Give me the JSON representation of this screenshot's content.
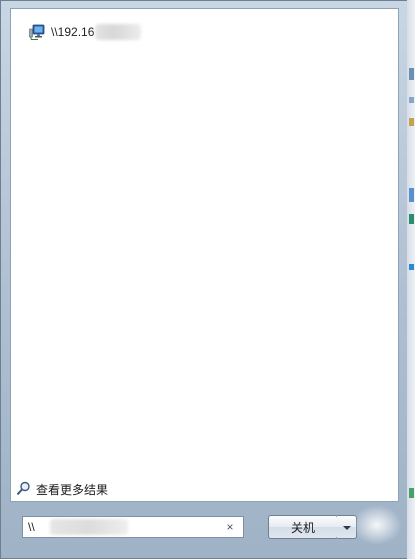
{
  "results": {
    "items": [
      {
        "label": "\\\\192.16",
        "icon": "network-computer-icon"
      }
    ]
  },
  "more_results": {
    "label": "查看更多结果",
    "icon": "search-icon"
  },
  "search": {
    "value": "\\\\",
    "clear_symbol": "×"
  },
  "shutdown": {
    "label": "关机"
  },
  "colors": {
    "frame": "#aebfd1",
    "panel": "#ffffff",
    "border": "#8ea2b8"
  }
}
